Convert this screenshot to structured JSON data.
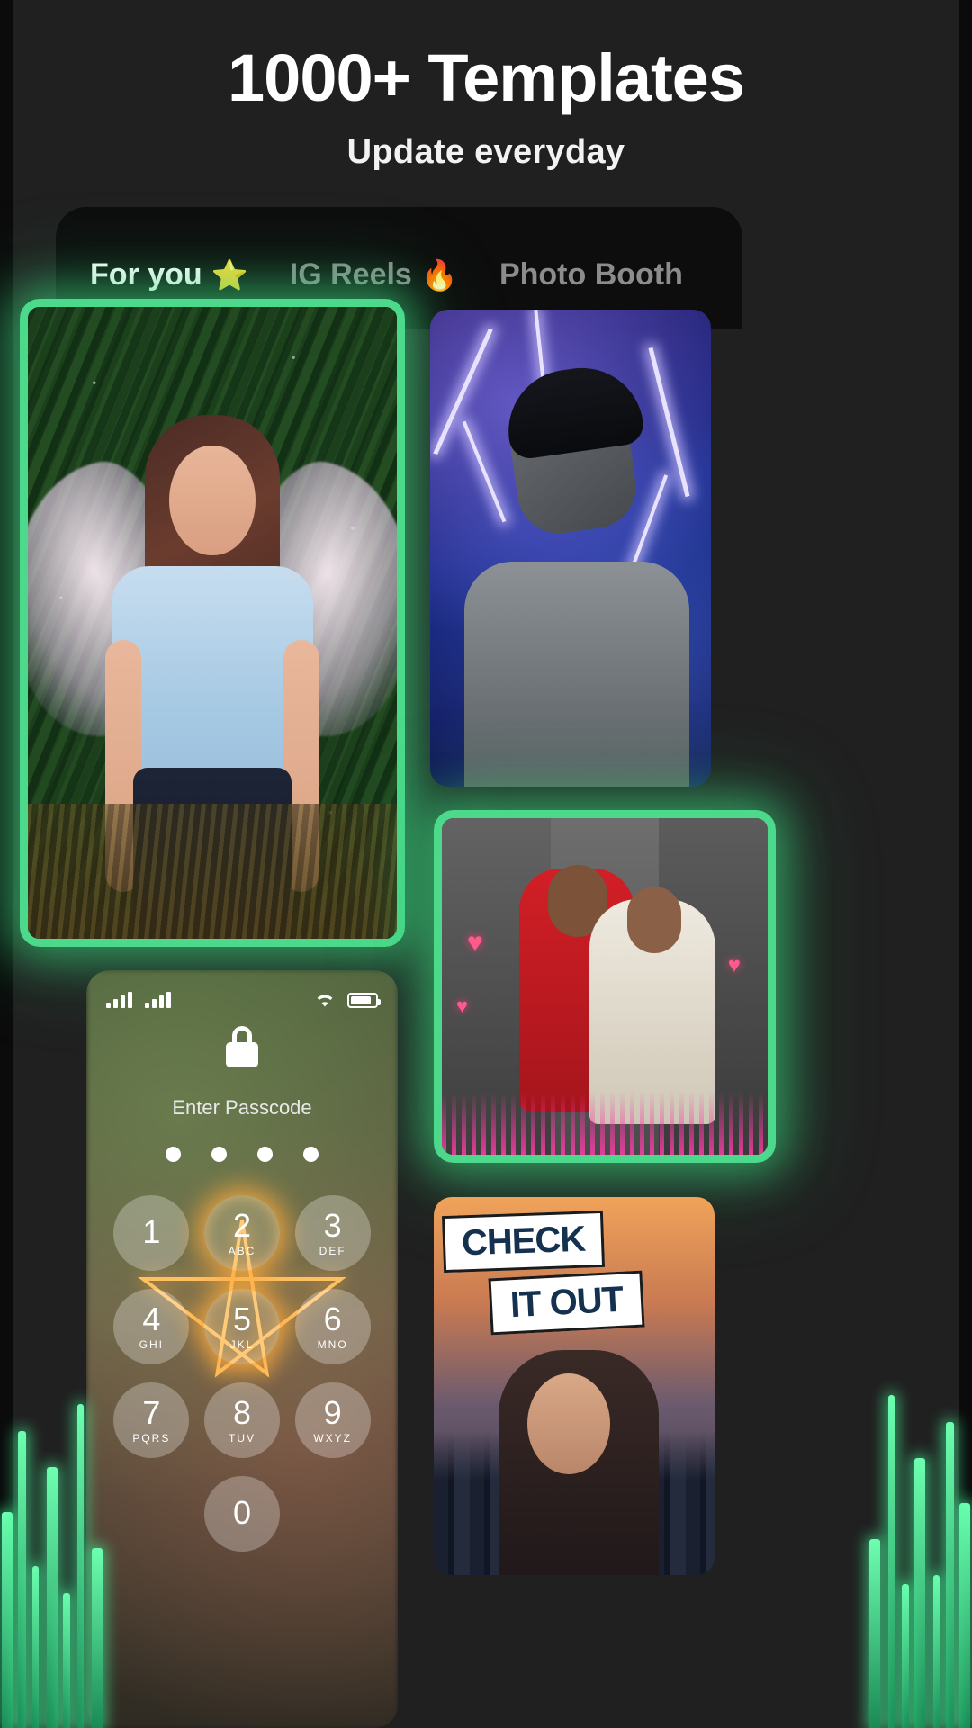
{
  "header": {
    "title": "1000+ Templates",
    "subtitle": "Update everyday"
  },
  "colors": {
    "background": "#202020",
    "panel": "#0d0d0d",
    "tab_active_text": "#ffffff",
    "tab_inactive_text": "#8c8c8c",
    "tab_underline": "#6fe0d4",
    "card_glow_border": "#4cd98b",
    "neon_green": "#6dffb0"
  },
  "tabs": [
    {
      "label": "For you",
      "emoji": "⭐",
      "active": true
    },
    {
      "label": "IG Reels",
      "emoji": "🔥",
      "active": false
    },
    {
      "label": "Photo Booth",
      "emoji": "",
      "active": false
    }
  ],
  "cards": [
    {
      "name": "fairy-forest-template",
      "highlighted": true
    },
    {
      "name": "lightning-portrait-template",
      "highlighted": false
    },
    {
      "name": "couple-collage-template",
      "highlighted": true
    },
    {
      "name": "lockscreen-passcode-template",
      "highlighted": false
    },
    {
      "name": "check-it-out-template",
      "highlighted": false
    }
  ],
  "lockscreen": {
    "passcode_label": "Enter Passcode",
    "dots": 4,
    "keys": [
      {
        "num": "1",
        "letters": ""
      },
      {
        "num": "2",
        "letters": "ABC",
        "lit": true
      },
      {
        "num": "3",
        "letters": "DEF"
      },
      {
        "num": "4",
        "letters": "GHI"
      },
      {
        "num": "5",
        "letters": "JKL",
        "lit": true
      },
      {
        "num": "6",
        "letters": "MNO"
      },
      {
        "num": "7",
        "letters": "PQRS"
      },
      {
        "num": "8",
        "letters": "TUV"
      },
      {
        "num": "9",
        "letters": "WXYZ"
      },
      {
        "num": "0",
        "letters": ""
      }
    ]
  },
  "check_card": {
    "word1": "CHECK",
    "word2": "IT OUT"
  }
}
